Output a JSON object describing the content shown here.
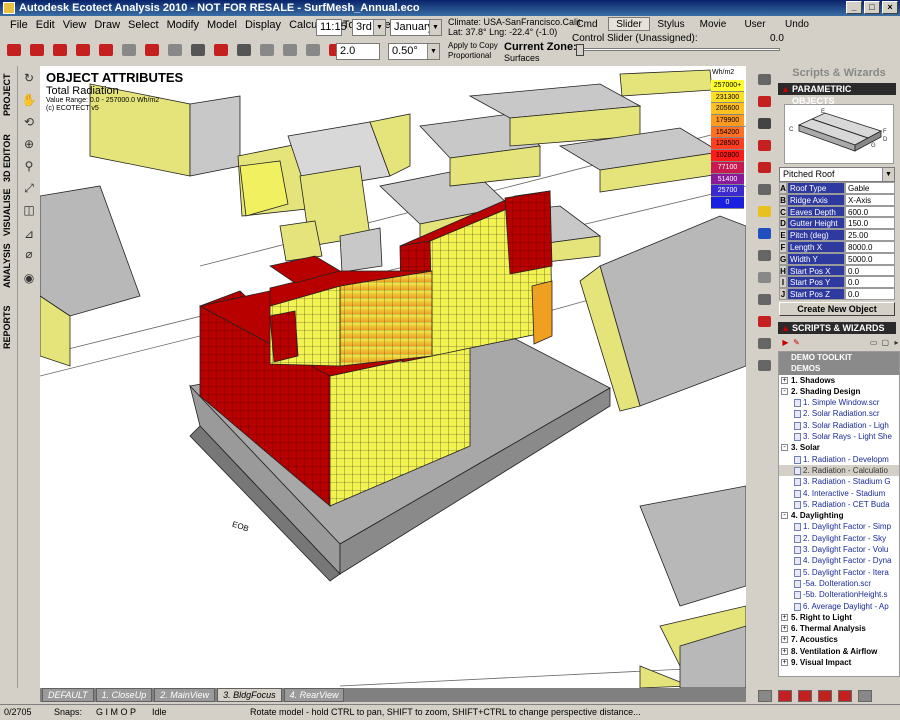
{
  "window": {
    "title": "Autodesk Ecotect Analysis 2010  -  NOT FOR RESALE  -  SurfMesh_Annual.eco"
  },
  "menu": [
    "File",
    "Edit",
    "View",
    "Draw",
    "Select",
    "Modify",
    "Model",
    "Display",
    "Calculate",
    "Tools",
    "Help"
  ],
  "time_controls": {
    "time": "11:15",
    "day": "3rd",
    "month": "January",
    "offset": "2.0",
    "grid": "0.50°"
  },
  "climate": {
    "line1": "Climate:  USA-SanFrancisco.Calit",
    "line2": "Lat: 37.8°     Lng: -22.4° (-1.0)"
  },
  "apply_copy": {
    "line1": "Apply to Copy",
    "line2": "Proportional"
  },
  "zone": {
    "label": "Current Zone:",
    "value": "Surfaces"
  },
  "top_tabs": [
    "Cmd",
    "Slider",
    "Stylus",
    "Movie",
    "User",
    "Undo"
  ],
  "active_top_tab": "Slider",
  "slider": {
    "label": "Control Slider (Unassigned):",
    "value": "0.0"
  },
  "left_tabs": [
    "PROJECT",
    "3D EDITOR",
    "VISUALISE",
    "ANALYSIS",
    "REPORTS"
  ],
  "viewport": {
    "title": "OBJECT ATTRIBUTES",
    "subtitle": "Total Radiation",
    "range_line1": "Value Range: 0.0 - 257000.0 Wh/m2",
    "range_line2": "(c) ECOTECT v5",
    "legend_units": "Wh/m2",
    "legend": [
      {
        "label": "257000+",
        "color": "#ffff30"
      },
      {
        "label": "231300",
        "color": "#ffe020"
      },
      {
        "label": "205600",
        "color": "#ffc020"
      },
      {
        "label": "179900",
        "color": "#ff9a20"
      },
      {
        "label": "154200",
        "color": "#ff7020"
      },
      {
        "label": "128500",
        "color": "#ff4020"
      },
      {
        "label": "102800",
        "color": "#ff1a1a"
      },
      {
        "label": "77100",
        "color": "#c81a50"
      },
      {
        "label": "51400",
        "color": "#8a1a9a"
      },
      {
        "label": "25700",
        "color": "#3a2ad0"
      },
      {
        "label": "0",
        "color": "#1a20e0"
      }
    ],
    "compass": "EOB"
  },
  "view_tabs": [
    "DEFAULT",
    "1. CloseUp",
    "2. MainView",
    "3. BldgFocus",
    "4. RearView"
  ],
  "active_view_tab": "3. BldgFocus",
  "status": {
    "count": "0/2705",
    "snaps_label": "Snaps:",
    "snaps": "G I   M O P",
    "state": "Idle",
    "hint": "Rotate model - hold CTRL to pan, SHIFT to zoom, SHIFT+CTRL to change perspective distance..."
  },
  "right_panel": {
    "title": "Scripts & Wizards",
    "parametric_header": "PARAMETRIC OBJECTS",
    "object_type": "Pitched Roof",
    "params": [
      {
        "key": "A",
        "label": "Roof Type",
        "value": "Gable"
      },
      {
        "key": "B",
        "label": "Ridge Axis",
        "value": "X-Axis"
      },
      {
        "key": "C",
        "label": "Eaves Depth",
        "value": "600.0"
      },
      {
        "key": "D",
        "label": "Gutter Height",
        "value": "150.0"
      },
      {
        "key": "E",
        "label": "Pitch (deg)",
        "value": "25.00"
      },
      {
        "key": "F",
        "label": "Length X",
        "value": "8000.0"
      },
      {
        "key": "G",
        "label": "Width Y",
        "value": "5000.0"
      },
      {
        "key": "H",
        "label": "Start Pos X",
        "value": "0.0"
      },
      {
        "key": "I",
        "label": "Start Pos Y",
        "value": "0.0"
      },
      {
        "key": "J",
        "label": "Start Pos Z",
        "value": "0.0"
      }
    ],
    "create_button": "Create New Object",
    "scripts_header": "SCRIPTS & WIZARDS",
    "tree": [
      {
        "type": "demo",
        "text": "DEMO TOOLKIT"
      },
      {
        "type": "demo",
        "text": "DEMOS"
      },
      {
        "type": "folder",
        "text": "1. Shadows",
        "exp": "+"
      },
      {
        "type": "folder",
        "text": "2. Shading Design",
        "exp": "-"
      },
      {
        "type": "item",
        "text": "1. Simple Window.scr"
      },
      {
        "type": "item",
        "text": "2. Solar Radiation.scr"
      },
      {
        "type": "item",
        "text": "3. Solar Radiation - Ligh"
      },
      {
        "type": "item",
        "text": "3. Solar Rays - Light She"
      },
      {
        "type": "folder",
        "text": "3. Solar",
        "exp": "-"
      },
      {
        "type": "item",
        "text": "1. Radiation - Developm"
      },
      {
        "type": "item",
        "text": "2. Radiation - Calculatio",
        "sel": true
      },
      {
        "type": "item",
        "text": "3. Radiation - Stadium G"
      },
      {
        "type": "item",
        "text": "4. Interactive - Stadium"
      },
      {
        "type": "item",
        "text": "5. Radiation - CET Buda"
      },
      {
        "type": "folder",
        "text": "4. Daylighting",
        "exp": "-"
      },
      {
        "type": "item",
        "text": "1. Daylight Factor - Simp"
      },
      {
        "type": "item",
        "text": "2. Daylight Factor - Sky"
      },
      {
        "type": "item",
        "text": "3. Daylight Factor - Volu"
      },
      {
        "type": "item",
        "text": "4. Daylight Factor - Dyna"
      },
      {
        "type": "item",
        "text": "5. Daylight Factor - Itera"
      },
      {
        "type": "item",
        "text": "-5a. DoIteration.scr"
      },
      {
        "type": "item",
        "text": "-5b. DoIterationHeight.s"
      },
      {
        "type": "item",
        "text": "6. Average Daylight - Ap"
      },
      {
        "type": "folder",
        "text": "5. Right to Light",
        "exp": "+"
      },
      {
        "type": "folder",
        "text": "6. Thermal Analysis",
        "exp": "+"
      },
      {
        "type": "folder",
        "text": "7. Acoustics",
        "exp": "+"
      },
      {
        "type": "folder",
        "text": "8. Ventilation & Airflow",
        "exp": "+"
      },
      {
        "type": "folder",
        "text": "9. Visual Impact",
        "exp": "+"
      }
    ]
  }
}
